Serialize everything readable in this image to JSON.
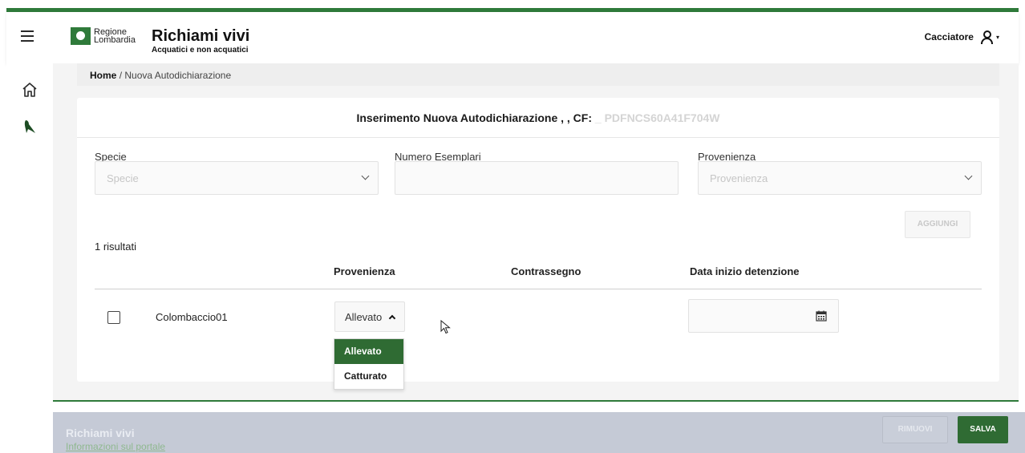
{
  "header": {
    "logo_line1": "Regione",
    "logo_line2": "Lombardia",
    "title": "Richiami vivi",
    "subtitle": "Acquatici e non acquatici",
    "user_label": "Cacciatore"
  },
  "breadcrumb": {
    "home": "Home",
    "separator": "/",
    "current": "Nuova Autodichiarazione"
  },
  "card": {
    "title_prefix": "Inserimento Nuova Autodichiarazione , , CF: ",
    "title_cf": "_ PDFNCS60A41F704W"
  },
  "form": {
    "specie_label": "Specie",
    "specie_placeholder": "Specie",
    "numero_label": "Numero Esemplari",
    "numero_value": "",
    "provenienza_label": "Provenienza",
    "provenienza_placeholder": "Provenienza",
    "add_button": "AGGIUNGI"
  },
  "results": {
    "count_text": "1 risultati",
    "columns": [
      "Provenienza",
      "Contrassegno",
      "Data inizio detenzione"
    ],
    "rows": [
      {
        "name": "Colombaccio01",
        "provenienza": "Allevato",
        "contrassegno": "",
        "data_inizio": ""
      }
    ],
    "dropdown_options": [
      "Allevato",
      "Catturato"
    ],
    "dropdown_selected": "Allevato"
  },
  "footer": {
    "title": "Richiami vivi",
    "link": "Informazioni sul portale",
    "remove_button": "RIMUOVI",
    "save_button": "SALVA"
  },
  "colors": {
    "brand_green": "#2f7a3a",
    "button_green": "#2f6b33",
    "footer_bg": "#c5cad6"
  }
}
